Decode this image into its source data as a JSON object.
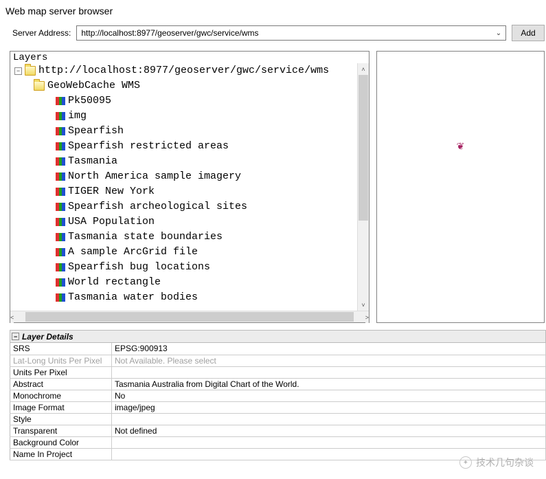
{
  "window": {
    "title": "Web map server browser"
  },
  "toolbar": {
    "address_label": "Server Address:",
    "address_value": "http://localhost:8977/geoserver/gwc/service/wms",
    "add_label": "Add"
  },
  "layers_panel": {
    "header": "Layers",
    "root_url": "http://localhost:8977/geoserver/gwc/service/wms",
    "service_name": "GeoWebCache WMS",
    "layers": [
      "Pk50095",
      "img",
      "Spearfish",
      "Spearfish restricted areas",
      "Tasmania",
      "North America sample imagery",
      "TIGER New York",
      "Spearfish archeological sites",
      "USA Population",
      "Tasmania state boundaries",
      "A sample ArcGrid file",
      "Spearfish bug locations",
      "World rectangle",
      "Tasmania water bodies"
    ]
  },
  "details": {
    "header": "Layer Details",
    "rows": [
      {
        "k": "SRS",
        "v": "EPSG:900913"
      },
      {
        "k": "Lat-Long Units Per Pixel",
        "v": "Not Available. Please select",
        "disabled": true
      },
      {
        "k": "Units Per Pixel",
        "v": ""
      },
      {
        "k": "Abstract",
        "v": "Tasmania Australia from Digital Chart of the World."
      },
      {
        "k": "Monochrome",
        "v": "No"
      },
      {
        "k": "Image Format",
        "v": "image/jpeg"
      },
      {
        "k": "Style",
        "v": ""
      },
      {
        "k": "Transparent",
        "v": "Not defined"
      },
      {
        "k": "Background Color",
        "v": ""
      },
      {
        "k": "Name In Project",
        "v": ""
      }
    ]
  },
  "watermark": "技术几句杂谈"
}
